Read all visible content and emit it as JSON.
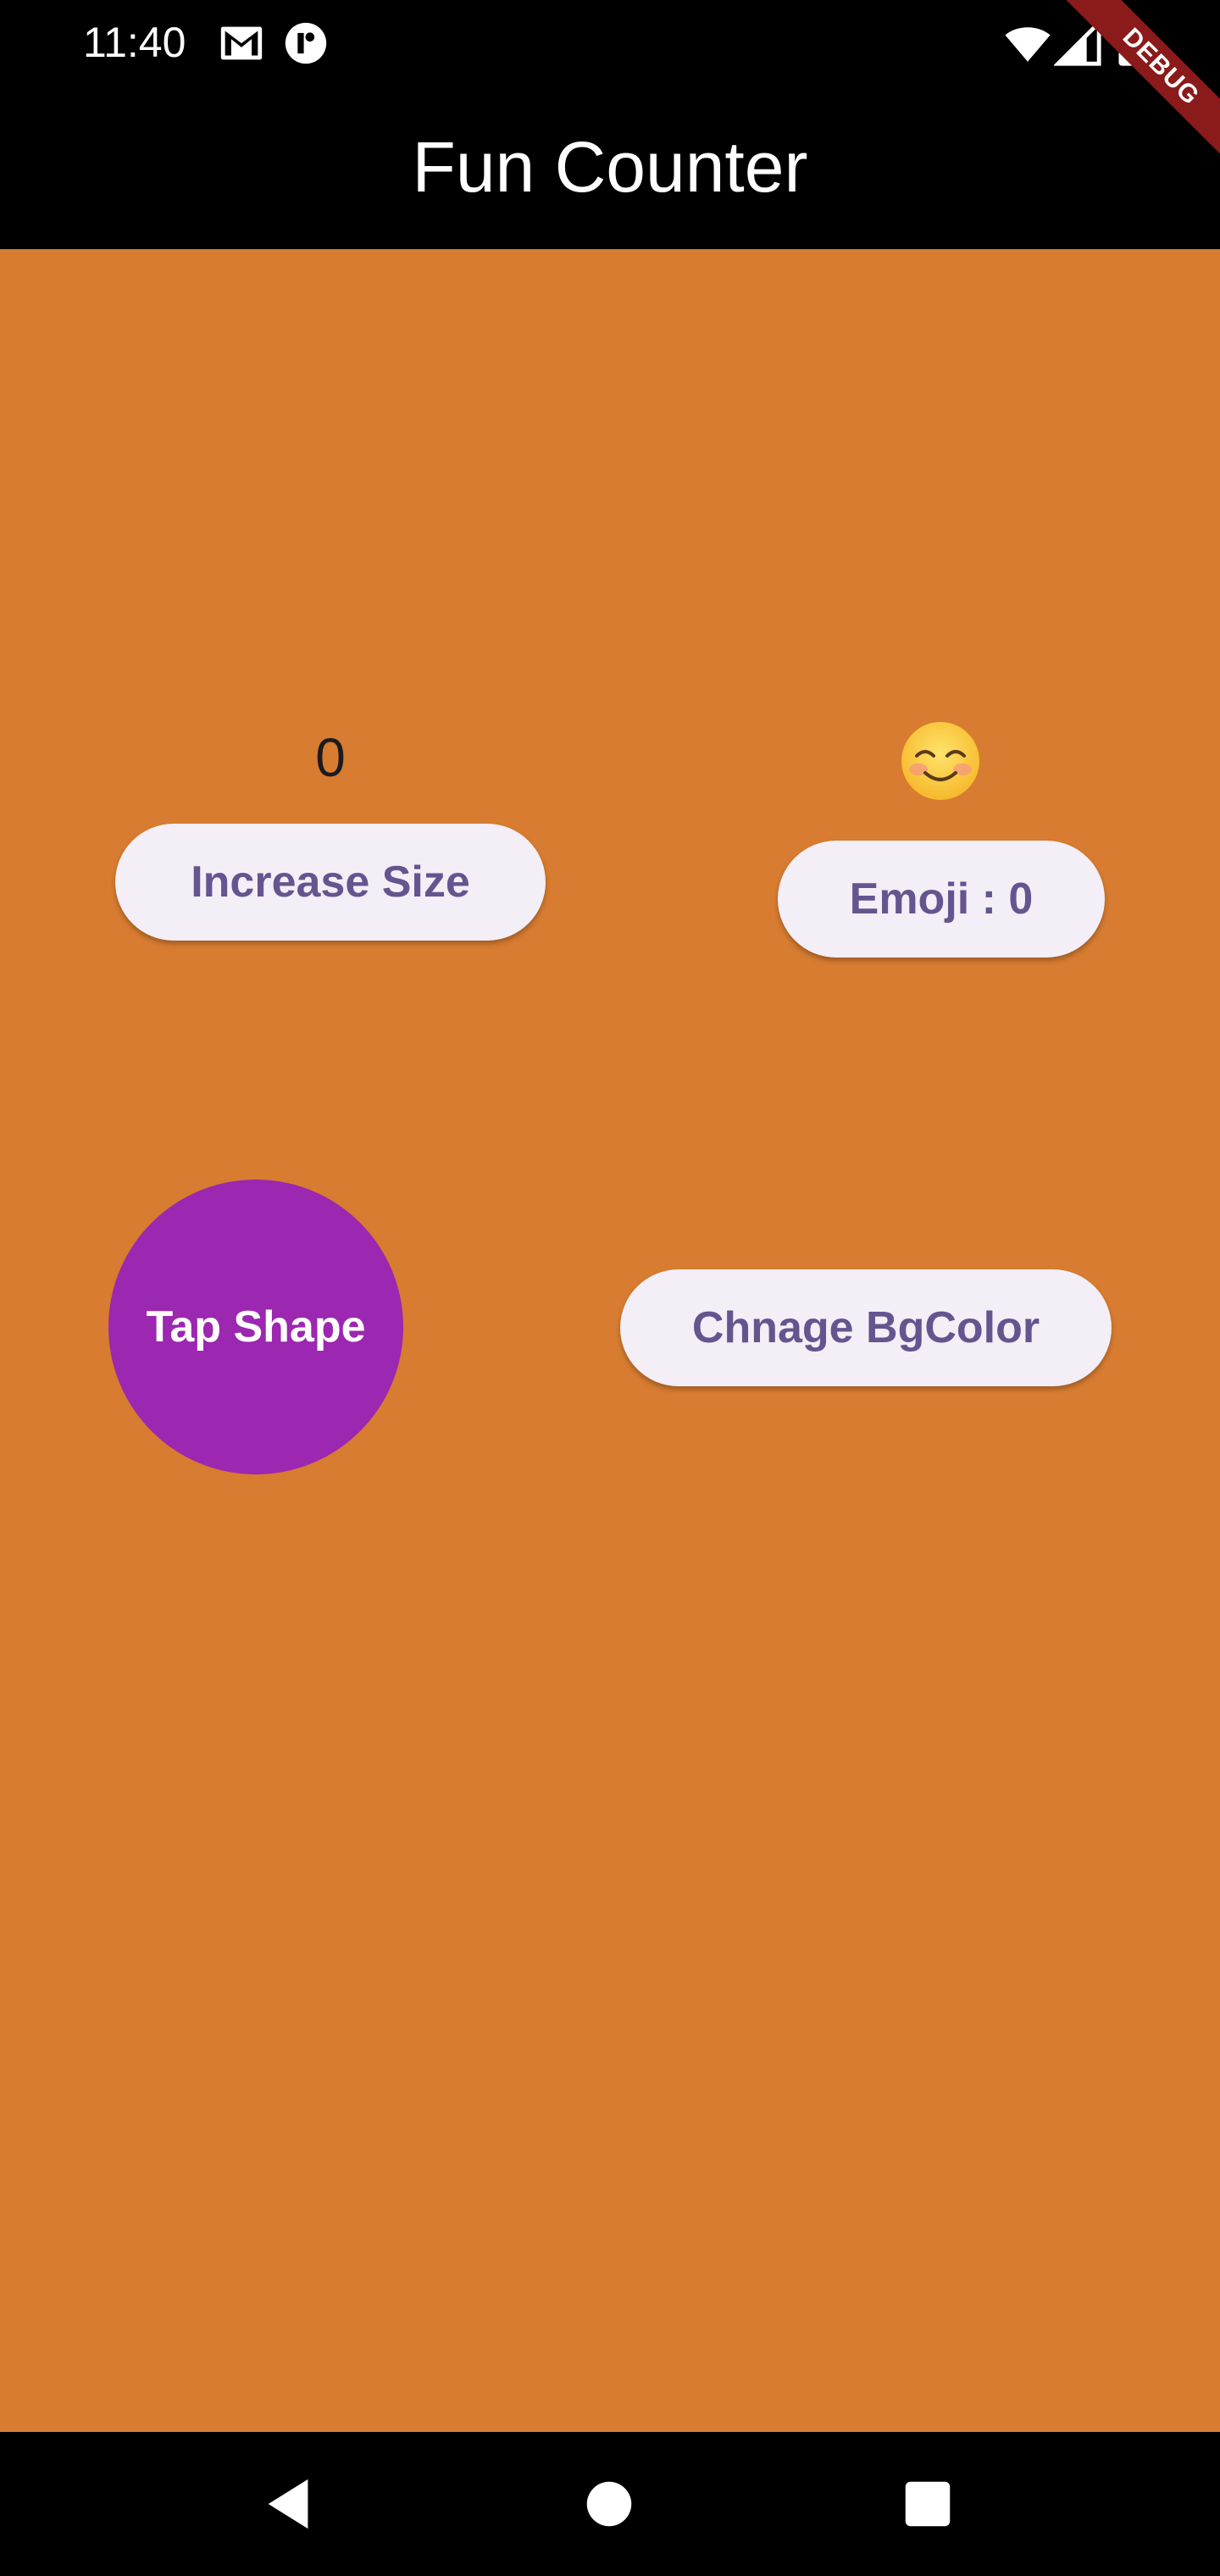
{
  "status_bar": {
    "time": "11:40",
    "icons": [
      "gmail-icon",
      "app-notification-icon",
      "wifi-icon",
      "signal-icon",
      "battery-icon"
    ]
  },
  "debug_banner": {
    "label": "DEBUG"
  },
  "app_bar": {
    "title": "Fun Counter"
  },
  "main": {
    "counter_value": "0",
    "increase_size_button": "Increase Size",
    "emoji_icon": "smiling-face-emoji",
    "emoji_button": "Emoji : 0",
    "tap_shape_label": "Tap Shape",
    "change_bg_button": "Chnage BgColor"
  },
  "nav_bar": {
    "buttons": [
      "back-icon",
      "home-icon",
      "recents-icon"
    ]
  },
  "colors": {
    "background": "#d77c30",
    "app_bar": "#000000",
    "button_bg": "#f4eef7",
    "button_text": "#65558f",
    "shape": "#9c27b0",
    "debug_ribbon": "#8b1a1a"
  }
}
